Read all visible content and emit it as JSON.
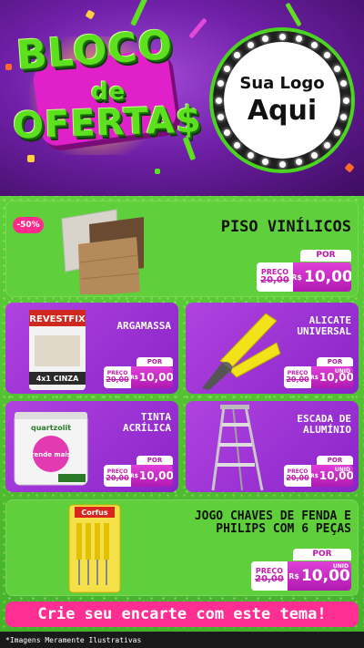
{
  "header": {
    "title_line1": "BLOCO",
    "title_line2": "de",
    "title_line3": "OFERTA$",
    "logo_line1": "Sua Logo",
    "logo_line2": "Aqui"
  },
  "colors": {
    "brand_green": "#5de01e",
    "brand_purple": "#8a24c8",
    "brand_pink": "#ff2e93"
  },
  "products": [
    {
      "name": "PISO VINÍLICOS",
      "discount": "-50%",
      "por_label": "POR",
      "preco_label": "PREÇO",
      "old_price": "20,00",
      "currency": "R$",
      "new_price": "10,00",
      "unit": ""
    },
    {
      "name": "ARGAMASSA",
      "por_label": "POR",
      "preco_label": "PREÇO",
      "old_price": "20,00",
      "currency": "R$",
      "new_price": "10,00",
      "unit": ""
    },
    {
      "name": "ALICATE UNIVERSAL",
      "por_label": "POR",
      "preco_label": "PREÇO",
      "old_price": "20,00",
      "currency": "R$",
      "new_price": "10,00",
      "unit": "UNID"
    },
    {
      "name": "TINTA ACRÍLICA",
      "por_label": "POR",
      "preco_label": "PREÇO",
      "old_price": "20,00",
      "currency": "R$",
      "new_price": "10,00",
      "unit": ""
    },
    {
      "name": "ESCADA DE ALUMÍNIO",
      "por_label": "POR",
      "preco_label": "PREÇO",
      "old_price": "20,00",
      "currency": "R$",
      "new_price": "10,00",
      "unit": "UNID"
    },
    {
      "name": "JOGO CHAVES DE FENDA E PHILIPS COM 6 PEÇAS",
      "por_label": "POR",
      "preco_label": "PREÇO",
      "old_price": "20,00",
      "currency": "R$",
      "new_price": "10,00",
      "unit": "UNID"
    }
  ],
  "product_images": {
    "argamassa_brand": "REVESTFIX",
    "argamassa_variant": "4x1 CINZA",
    "tinta_brand": "quartzolit",
    "tinta_badge": "rende mais",
    "chaves_brand": "Corfus"
  },
  "cta": "Crie seu encarte com este tema!",
  "footer": "*Imagens Meramente Ilustrativas"
}
